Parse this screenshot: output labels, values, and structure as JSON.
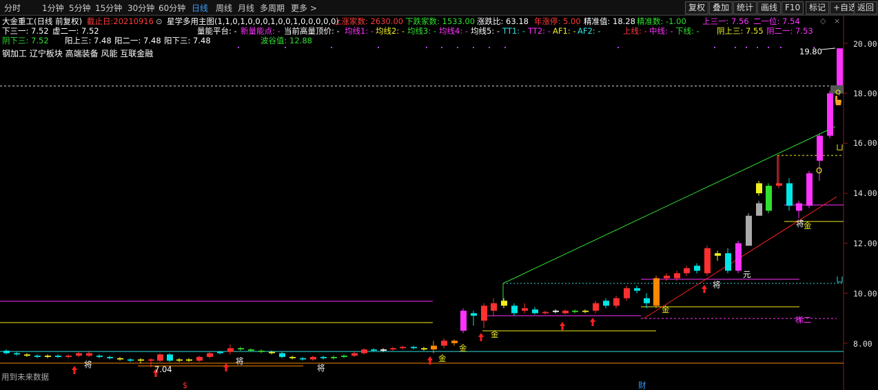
{
  "toolbar": {
    "periods": [
      "分时",
      "1分钟",
      "5分钟",
      "15分钟",
      "30分钟",
      "60分钟",
      "日线",
      "周线",
      "月线",
      "多周期",
      "更多"
    ],
    "active_period": "日线",
    "right_buttons": [
      "复权",
      "叠加",
      "统计",
      "画线",
      "F10",
      "标记",
      "+自选",
      "返回"
    ]
  },
  "stock": {
    "title": "大金重工(日线 前复权)",
    "cutoff": "截止日:20210916",
    "indicator": "星学多用主图(1,1,0,1,0,0,0,1,0,0,1,0,0,0,0,0)",
    "up_count": "上涨家数: 2630.00",
    "down_count": "下跌家数: 1533.00",
    "ratio": "涨跌比: 63.18",
    "limit_up": "年涨停: 5.00",
    "precise": "精准值: 18.28",
    "precise_num": "精准数: -1.00",
    "up3": "上三一: 7.56",
    "two1": "二一位: 7.54"
  },
  "row2": {
    "down3": "下三一: 7.52",
    "virtual": "虚二一: 7.52",
    "platform": "量能平台: -",
    "new_power": "新量能点: -",
    "high_top": "当前高量顶价: -",
    "ma1": "均线1: -",
    "ma2": "均线2: -",
    "ma3": "均线3: -",
    "ma4": "均线4: -",
    "ma5": "均线5: -",
    "tt1": "TT1: -",
    "tt2": "TT2: -",
    "af1": "AF1: -",
    "af2": "AF2: -",
    "upper": "上线: -",
    "middle": "中线: -",
    "lower": "下线: -",
    "yang_up3": "阴上三: 7.55",
    "yin_two1": "阴二一: 7.53"
  },
  "row3": {
    "yin_down3": "阴下三: 7.52",
    "yang_up3": "阳上三: 7.48",
    "yang_two1": "阳二一: 7.48",
    "yang_down3": "阳下三: 7.48",
    "valley": "波谷值: 12.88"
  },
  "sectors": "钢加工 辽宁板块 高端装备 风能 互联金融",
  "price_axis": [
    "20.00",
    "18.00",
    "16.00",
    "14.00",
    "12.00",
    "10.00",
    "8.00"
  ],
  "annotations": {
    "high_price": "19.80",
    "low_price": "7.04",
    "future_data": "用到未来数据",
    "money": "$",
    "finance": "财",
    "jiang": "将",
    "jin": "金",
    "yuan": "元",
    "ladder2": "梯二",
    "o": "O"
  },
  "colors": {
    "up": "#ff3030",
    "down": "#00e5e5",
    "pink": "#ff33ff",
    "yellow": "#f0f020",
    "green": "#30e030",
    "gray": "#909090"
  }
}
